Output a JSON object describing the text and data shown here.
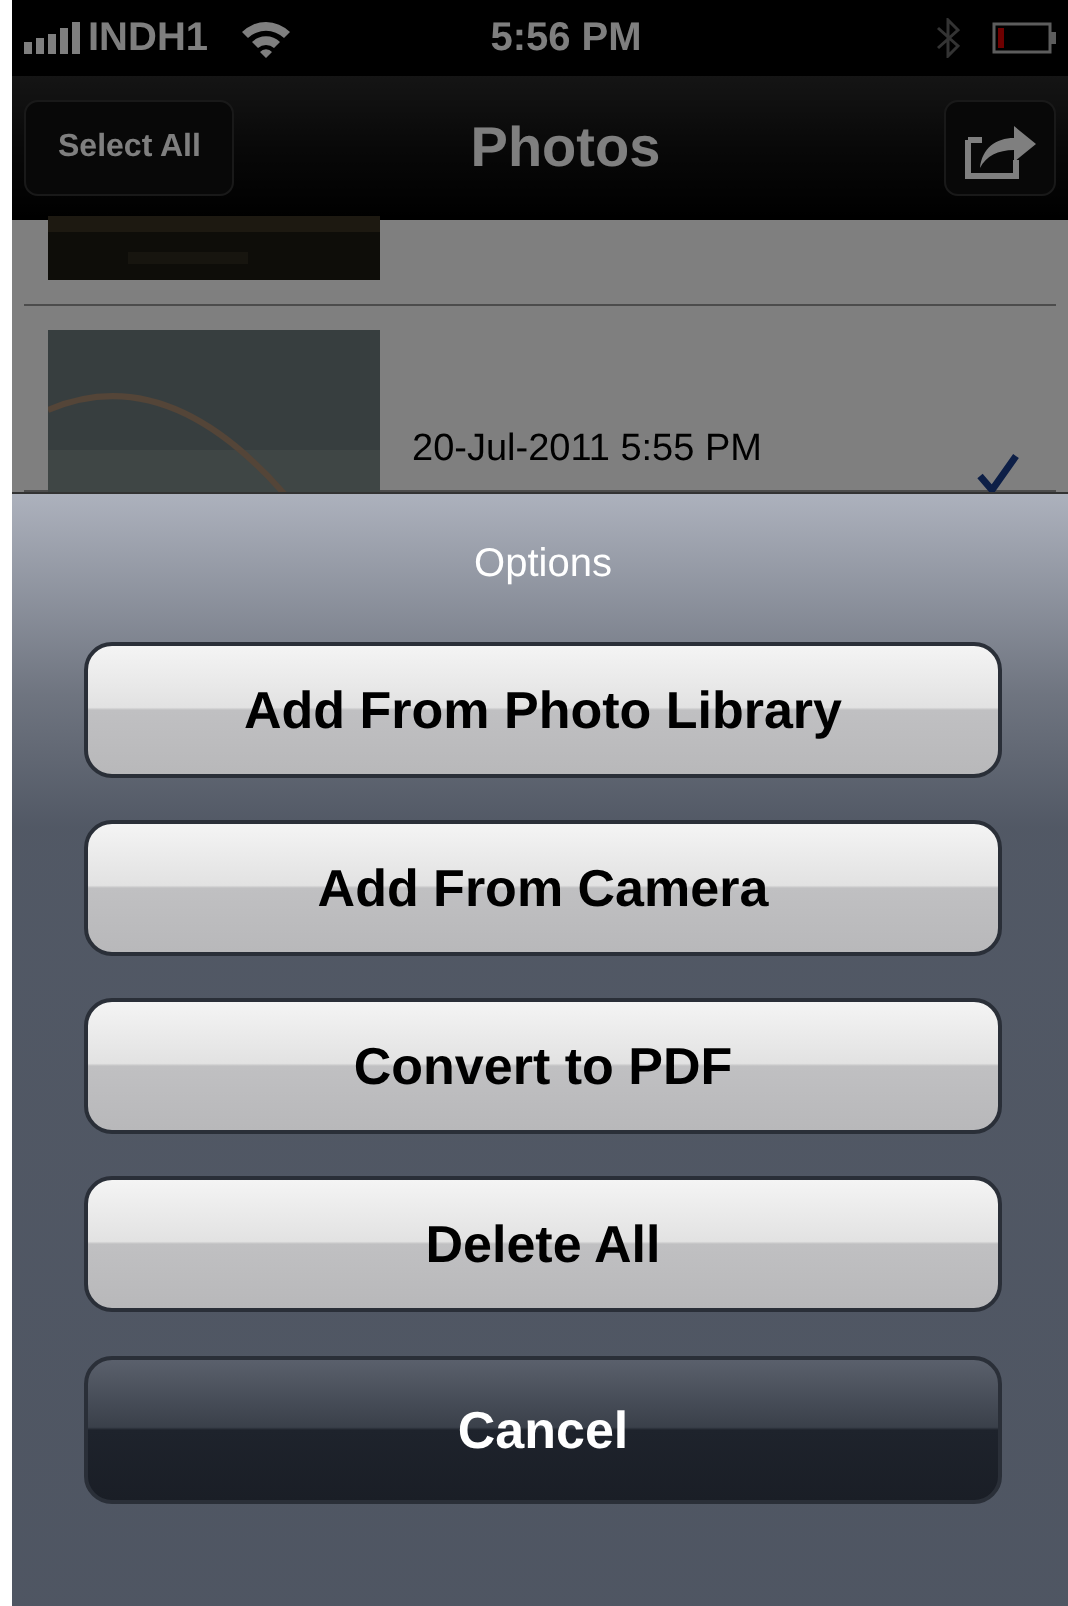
{
  "status_bar": {
    "carrier": "INDH1",
    "time": "5:56 PM"
  },
  "nav_bar": {
    "left_button": "Select All",
    "title": "Photos"
  },
  "rows": [
    {
      "kind": "picture",
      "selected": false
    },
    {
      "kind": "picture",
      "date": "20-Jul-2011 5:55 PM",
      "selected": true
    }
  ],
  "action_sheet": {
    "title": "Options",
    "buttons": [
      {
        "label": "Add From Photo Library",
        "kind": "default"
      },
      {
        "label": "Add From Camera",
        "kind": "default"
      },
      {
        "label": "Convert to PDF",
        "kind": "default"
      },
      {
        "label": "Delete All",
        "kind": "default"
      },
      {
        "label": "Cancel",
        "kind": "cancel"
      }
    ]
  }
}
